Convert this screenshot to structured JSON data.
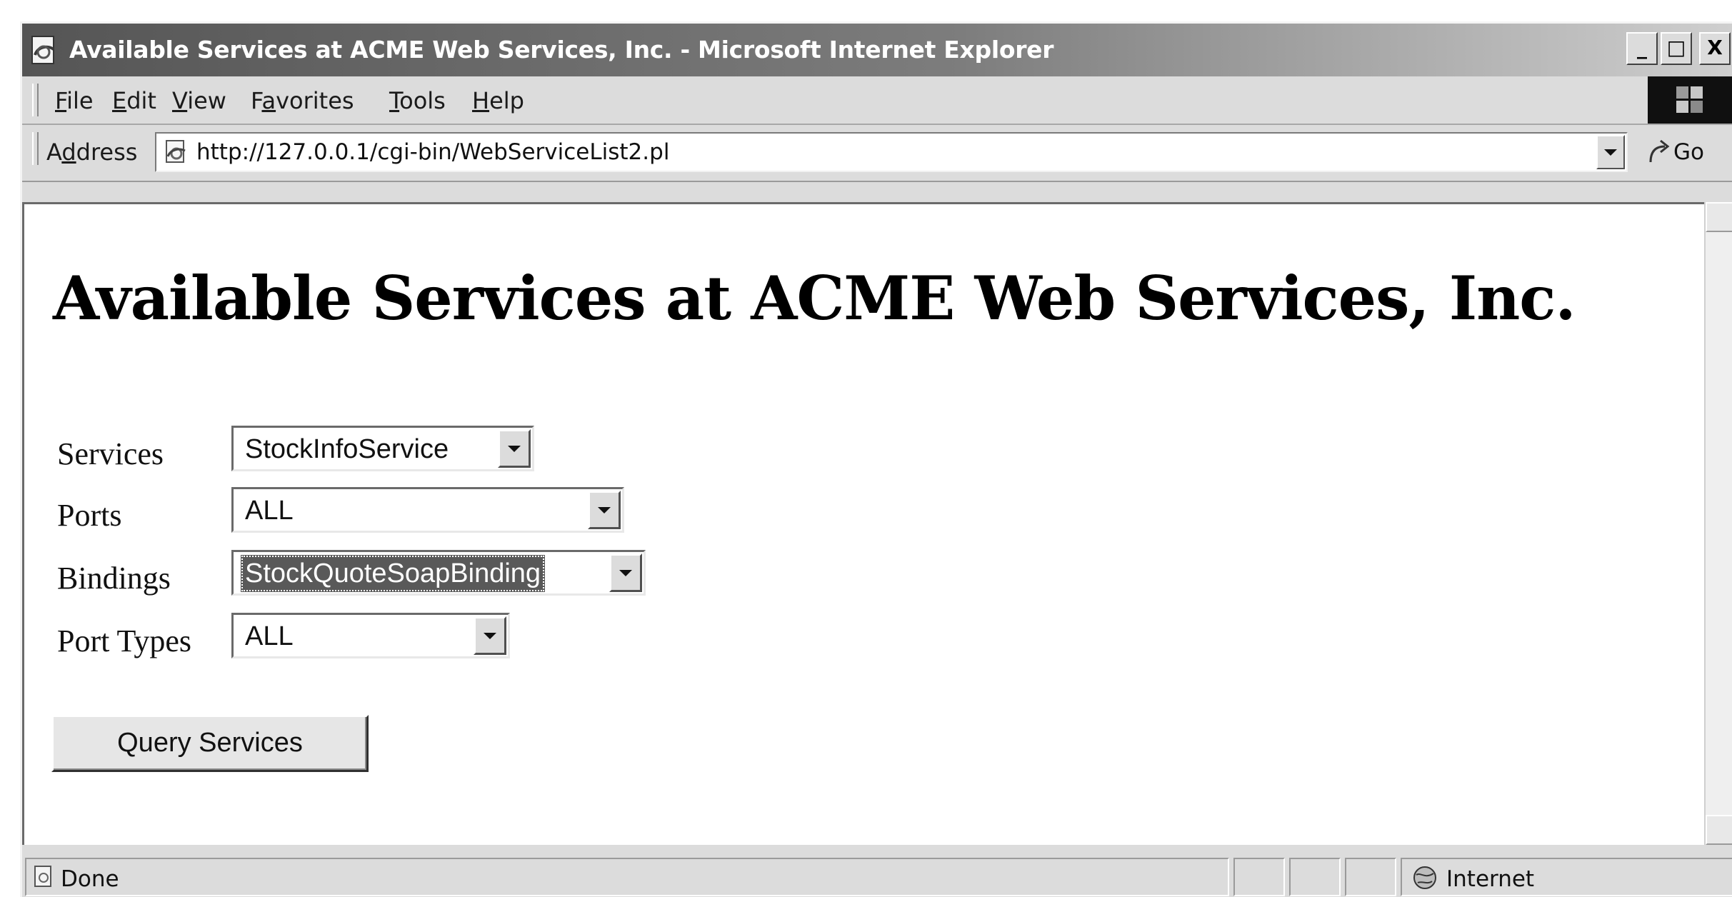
{
  "window": {
    "title": "Available Services at ACME Web Services, Inc. - Microsoft Internet Explorer",
    "minimize_glyph": "_",
    "maximize_glyph": "□",
    "close_glyph": "X"
  },
  "menubar": {
    "items": [
      {
        "mnemonic": "F",
        "rest": "ile"
      },
      {
        "mnemonic": "E",
        "rest": "dit"
      },
      {
        "mnemonic": "V",
        "rest": "iew"
      },
      {
        "pre": "F",
        "mnemonic": "a",
        "rest": "vorites"
      },
      {
        "mnemonic": "T",
        "rest": "ools"
      },
      {
        "mnemonic": "H",
        "rest": "elp"
      }
    ]
  },
  "address": {
    "label_pre": "A",
    "label_mnemonic": "d",
    "label_rest": "dress",
    "url": "http://127.0.0.1/cgi-bin/WebServiceList2.pl",
    "go_label": "Go"
  },
  "page": {
    "heading": "Available Services at ACME Web Services, Inc.",
    "form": {
      "services_label": "Services",
      "services_value": "StockInfoService",
      "ports_label": "Ports",
      "ports_value": "ALL",
      "bindings_label": "Bindings",
      "bindings_value": "StockQuoteSoapBinding",
      "port_types_label": "Port Types",
      "port_types_value": "ALL",
      "submit_label": "Query Services"
    }
  },
  "statusbar": {
    "status_text": "Done",
    "zone_text": "Internet"
  },
  "colors": {
    "title_gradient_start": "#555555",
    "selected_option_bg": "#595959"
  }
}
